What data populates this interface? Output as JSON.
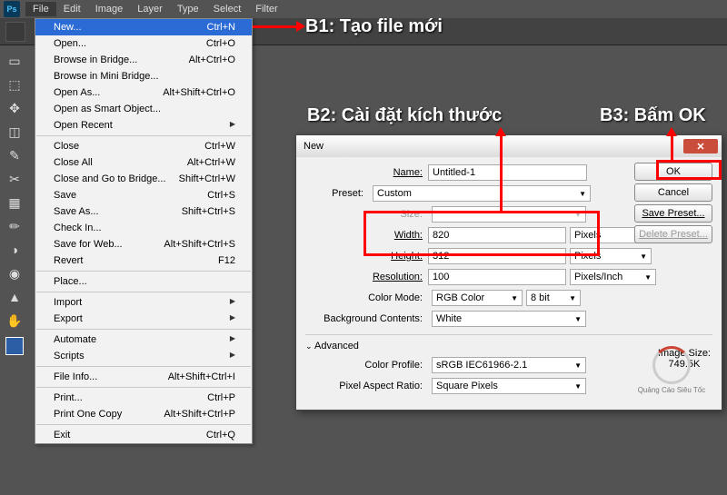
{
  "menubar": [
    "File",
    "Edit",
    "Image",
    "Layer",
    "Type",
    "Select",
    "Filter"
  ],
  "dropdown": {
    "groups": [
      [
        [
          "New...",
          "Ctrl+N",
          true
        ],
        [
          "Open...",
          "Ctrl+O"
        ],
        [
          "Browse in Bridge...",
          "Alt+Ctrl+O"
        ],
        [
          "Browse in Mini Bridge...",
          ""
        ],
        [
          "Open As...",
          "Alt+Shift+Ctrl+O"
        ],
        [
          "Open as Smart Object...",
          ""
        ],
        [
          "Open Recent",
          "sub"
        ]
      ],
      [
        [
          "Close",
          "Ctrl+W"
        ],
        [
          "Close All",
          "Alt+Ctrl+W"
        ],
        [
          "Close and Go to Bridge...",
          "Shift+Ctrl+W"
        ],
        [
          "Save",
          "Ctrl+S"
        ],
        [
          "Save As...",
          "Shift+Ctrl+S"
        ],
        [
          "Check In...",
          ""
        ],
        [
          "Save for Web...",
          "Alt+Shift+Ctrl+S"
        ],
        [
          "Revert",
          "F12"
        ]
      ],
      [
        [
          "Place...",
          ""
        ]
      ],
      [
        [
          "Import",
          "sub"
        ],
        [
          "Export",
          "sub"
        ]
      ],
      [
        [
          "Automate",
          "sub"
        ],
        [
          "Scripts",
          "sub"
        ]
      ],
      [
        [
          "File Info...",
          "Alt+Shift+Ctrl+I"
        ]
      ],
      [
        [
          "Print...",
          "Ctrl+P"
        ],
        [
          "Print One Copy",
          "Alt+Shift+Ctrl+P"
        ]
      ],
      [
        [
          "Exit",
          "Ctrl+Q"
        ]
      ]
    ]
  },
  "dialog": {
    "title": "New",
    "name_lbl": "Name:",
    "name_val": "Untitled-1",
    "preset_lbl": "Preset:",
    "preset_val": "Custom",
    "size_lbl": "Size:",
    "width_lbl": "Width:",
    "width_val": "820",
    "width_unit": "Pixels",
    "height_lbl": "Height:",
    "height_val": "312",
    "height_unit": "Pixels",
    "res_lbl": "Resolution:",
    "res_val": "100",
    "res_unit": "Pixels/Inch",
    "mode_lbl": "Color Mode:",
    "mode_val": "RGB Color",
    "mode_bit": "8 bit",
    "bg_lbl": "Background Contents:",
    "bg_val": "White",
    "adv": "Advanced",
    "profile_lbl": "Color Profile:",
    "profile_val": "sRGB IEC61966-2.1",
    "aspect_lbl": "Pixel Aspect Ratio:",
    "aspect_val": "Square Pixels",
    "btn_ok": "OK",
    "btn_cancel": "Cancel",
    "btn_save": "Save Preset...",
    "btn_del": "Delete Preset...",
    "imgsize_lbl": "Image Size:",
    "imgsize_val": "749.5K"
  },
  "annot": {
    "b1": "B1: Tạo file mới",
    "b2": "B2: Cài đặt kích thước",
    "b3": "B3: Bấm OK"
  },
  "tools": [
    "▭",
    "⬚",
    "✥",
    "◫",
    "✎",
    "✂",
    "▦",
    "✏",
    "◑",
    "◉",
    "▲",
    "✋"
  ],
  "logo_text": "Quảng Cáo Siêu Tốc"
}
